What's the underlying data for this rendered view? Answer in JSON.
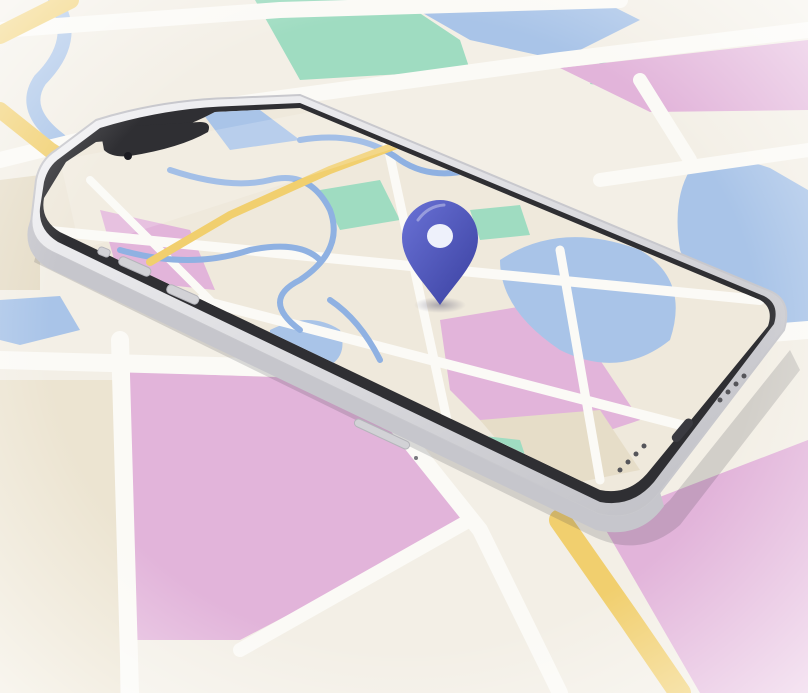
{
  "image": {
    "subject": "smartphone-on-map",
    "icon": "location-pin-icon",
    "colors": {
      "background": "#f3efe6",
      "road": "#fbfaf6",
      "water": "#a9c4e8",
      "park": "#9fdcc1",
      "block_pink": "#e2b4da",
      "block_tan": "#e6ddc8",
      "highway": "#f1cf6e",
      "phone_body": "#e4e4e6",
      "phone_bezel": "#2f2f33",
      "pin": "#4b53b8"
    }
  }
}
